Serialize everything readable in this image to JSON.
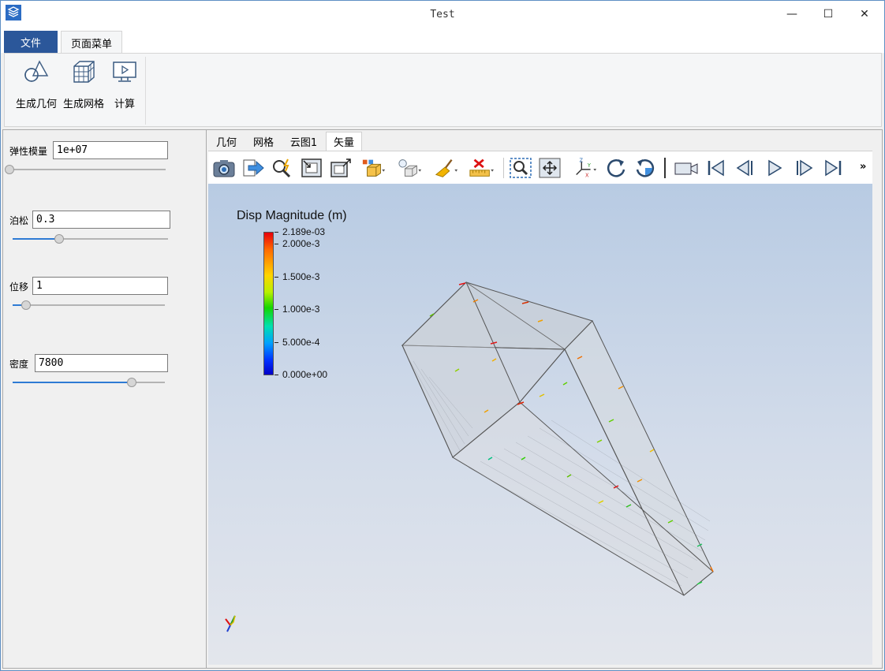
{
  "window": {
    "title": "Test",
    "minimize": "—",
    "maximize": "☐",
    "close": "✕"
  },
  "menu": {
    "file": "文件",
    "page": "页面菜单"
  },
  "ribbon": {
    "buttons": [
      {
        "label": "生成几何",
        "icon": "geometry-shapes-icon"
      },
      {
        "label": "生成网格",
        "icon": "mesh-cube-icon"
      },
      {
        "label": "计算",
        "icon": "monitor-play-icon"
      }
    ]
  },
  "params": {
    "modulus": {
      "label": "弹性模量",
      "value": "1e+07",
      "slider": 0.0
    },
    "poisson": {
      "label": "泊松",
      "value": "0.3",
      "slider": 0.3
    },
    "displacement": {
      "label": "位移",
      "value": "1",
      "slider": 0.09
    },
    "density": {
      "label": "密度",
      "value": "7800",
      "slider": 0.78
    }
  },
  "view_tabs": [
    "几何",
    "网格",
    "云图1",
    "矢量"
  ],
  "active_view_tab": "矢量",
  "toolbar": {
    "icons": [
      "camera-icon",
      "export-arrow-icon",
      "zoom-lightning-icon",
      "frame-inward-icon",
      "frame-outward-icon",
      "color-cube-icon",
      "light-cube-icon",
      "broom-icon",
      "ruler-delete-icon",
      "zoom-box-icon",
      "fit-view-icon",
      "axes-icon",
      "rotate-cw-icon",
      "rotate-ccw-icon",
      "video-camera-icon",
      "first-frame-icon",
      "previous-frame-icon",
      "play-icon",
      "next-frame-icon",
      "last-frame-icon"
    ],
    "more": "»"
  },
  "colorbar": {
    "title": "Disp Magnitude (m)",
    "labels": [
      "2.189e-03",
      "2.000e-3",
      "1.500e-3",
      "1.000e-3",
      "5.000e-4",
      "0.000e+00"
    ],
    "min": 0.0,
    "max": 0.002189
  },
  "colors": {
    "accent": "#2b579a",
    "slider_fill": "#2e7bd4"
  }
}
